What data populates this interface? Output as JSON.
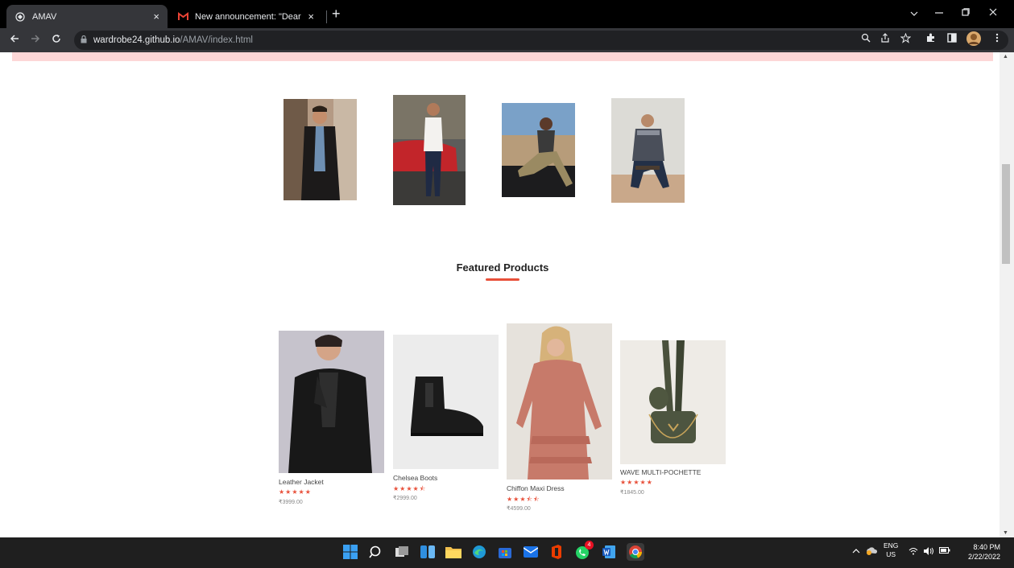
{
  "browser": {
    "tabs": [
      {
        "title": "AMAV",
        "active": true
      },
      {
        "title": "New announcement: \"Dear stude",
        "active": false
      }
    ],
    "new_tab": "+",
    "close_glyph": "×",
    "url_host": "wardrobe24.github.io",
    "url_path": "/AMAV/index.html"
  },
  "featured": {
    "title": "Featured Products",
    "accent_color": "#e8503a"
  },
  "products": [
    {
      "name": "Leather Jacket",
      "stars": "★★★★★",
      "rating": 5,
      "price": "₹3999.00"
    },
    {
      "name": "Chelsea Boots",
      "stars": "★★★★⯪",
      "rating": 4.5,
      "price": "₹2999.00"
    },
    {
      "name": "Chiffon Maxi Dress",
      "stars": "★★★⯪⯪",
      "rating": 3.5,
      "price": "₹4599.00"
    },
    {
      "name": "WAVE MULTI-POCHETTE",
      "stars": "★★★★★",
      "rating": 5,
      "price": "₹1845.00"
    }
  ],
  "taskbar": {
    "lang_line1": "ENG",
    "lang_line2": "US",
    "time": "8:40 PM",
    "date": "2/22/2022",
    "whatsapp_badge": "4"
  }
}
